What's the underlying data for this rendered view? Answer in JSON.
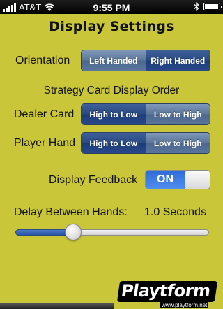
{
  "status_bar": {
    "carrier": "AT&T",
    "time": "9:55 PM",
    "battery_level": 0.95,
    "icons": [
      "signal-icon",
      "wifi-icon",
      "bluetooth-icon",
      "battery-icon"
    ]
  },
  "title": "Display Settings",
  "orientation": {
    "label": "Orientation",
    "options": [
      "Left Handed",
      "Right Handed"
    ],
    "selected": "Right Handed"
  },
  "strategy_heading": "Strategy Card Display Order",
  "dealer_card": {
    "label": "Dealer Card",
    "options": [
      "High to Low",
      "Low to High"
    ],
    "selected": "High to Low"
  },
  "player_hand": {
    "label": "Player Hand",
    "options": [
      "High to Low",
      "Low to High"
    ],
    "selected": "High to Low"
  },
  "display_feedback": {
    "label": "Display Feedback",
    "state": "ON"
  },
  "delay": {
    "label": "Delay Between Hands:",
    "value_text": "1.0 Seconds",
    "fraction": 0.28
  },
  "watermark": {
    "brand": "Playtform",
    "url": "www.playtform.net"
  },
  "colors": {
    "background": "#c9c63a",
    "segment": "#5a7599",
    "segment_selected": "#2a4a84",
    "toggle_on": "#3a78e0"
  }
}
